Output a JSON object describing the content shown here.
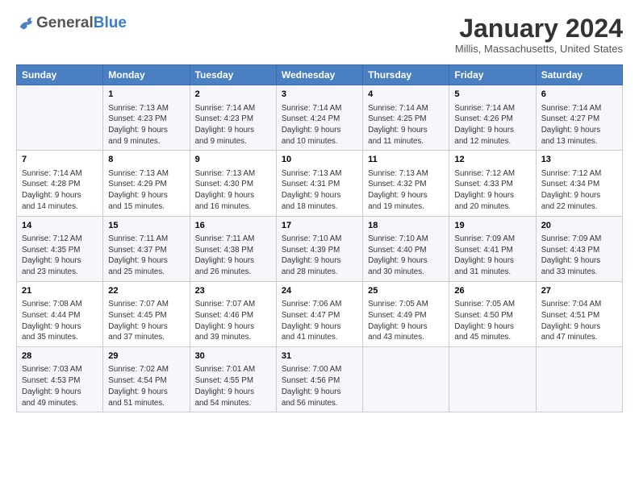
{
  "header": {
    "logo_general": "General",
    "logo_blue": "Blue",
    "title": "January 2024",
    "subtitle": "Millis, Massachusetts, United States"
  },
  "columns": [
    "Sunday",
    "Monday",
    "Tuesday",
    "Wednesday",
    "Thursday",
    "Friday",
    "Saturday"
  ],
  "weeks": [
    [
      {
        "num": "",
        "lines": []
      },
      {
        "num": "1",
        "lines": [
          "Sunrise: 7:13 AM",
          "Sunset: 4:23 PM",
          "Daylight: 9 hours",
          "and 9 minutes."
        ]
      },
      {
        "num": "2",
        "lines": [
          "Sunrise: 7:14 AM",
          "Sunset: 4:23 PM",
          "Daylight: 9 hours",
          "and 9 minutes."
        ]
      },
      {
        "num": "3",
        "lines": [
          "Sunrise: 7:14 AM",
          "Sunset: 4:24 PM",
          "Daylight: 9 hours",
          "and 10 minutes."
        ]
      },
      {
        "num": "4",
        "lines": [
          "Sunrise: 7:14 AM",
          "Sunset: 4:25 PM",
          "Daylight: 9 hours",
          "and 11 minutes."
        ]
      },
      {
        "num": "5",
        "lines": [
          "Sunrise: 7:14 AM",
          "Sunset: 4:26 PM",
          "Daylight: 9 hours",
          "and 12 minutes."
        ]
      },
      {
        "num": "6",
        "lines": [
          "Sunrise: 7:14 AM",
          "Sunset: 4:27 PM",
          "Daylight: 9 hours",
          "and 13 minutes."
        ]
      }
    ],
    [
      {
        "num": "7",
        "lines": [
          "Sunrise: 7:14 AM",
          "Sunset: 4:28 PM",
          "Daylight: 9 hours",
          "and 14 minutes."
        ]
      },
      {
        "num": "8",
        "lines": [
          "Sunrise: 7:13 AM",
          "Sunset: 4:29 PM",
          "Daylight: 9 hours",
          "and 15 minutes."
        ]
      },
      {
        "num": "9",
        "lines": [
          "Sunrise: 7:13 AM",
          "Sunset: 4:30 PM",
          "Daylight: 9 hours",
          "and 16 minutes."
        ]
      },
      {
        "num": "10",
        "lines": [
          "Sunrise: 7:13 AM",
          "Sunset: 4:31 PM",
          "Daylight: 9 hours",
          "and 18 minutes."
        ]
      },
      {
        "num": "11",
        "lines": [
          "Sunrise: 7:13 AM",
          "Sunset: 4:32 PM",
          "Daylight: 9 hours",
          "and 19 minutes."
        ]
      },
      {
        "num": "12",
        "lines": [
          "Sunrise: 7:12 AM",
          "Sunset: 4:33 PM",
          "Daylight: 9 hours",
          "and 20 minutes."
        ]
      },
      {
        "num": "13",
        "lines": [
          "Sunrise: 7:12 AM",
          "Sunset: 4:34 PM",
          "Daylight: 9 hours",
          "and 22 minutes."
        ]
      }
    ],
    [
      {
        "num": "14",
        "lines": [
          "Sunrise: 7:12 AM",
          "Sunset: 4:35 PM",
          "Daylight: 9 hours",
          "and 23 minutes."
        ]
      },
      {
        "num": "15",
        "lines": [
          "Sunrise: 7:11 AM",
          "Sunset: 4:37 PM",
          "Daylight: 9 hours",
          "and 25 minutes."
        ]
      },
      {
        "num": "16",
        "lines": [
          "Sunrise: 7:11 AM",
          "Sunset: 4:38 PM",
          "Daylight: 9 hours",
          "and 26 minutes."
        ]
      },
      {
        "num": "17",
        "lines": [
          "Sunrise: 7:10 AM",
          "Sunset: 4:39 PM",
          "Daylight: 9 hours",
          "and 28 minutes."
        ]
      },
      {
        "num": "18",
        "lines": [
          "Sunrise: 7:10 AM",
          "Sunset: 4:40 PM",
          "Daylight: 9 hours",
          "and 30 minutes."
        ]
      },
      {
        "num": "19",
        "lines": [
          "Sunrise: 7:09 AM",
          "Sunset: 4:41 PM",
          "Daylight: 9 hours",
          "and 31 minutes."
        ]
      },
      {
        "num": "20",
        "lines": [
          "Sunrise: 7:09 AM",
          "Sunset: 4:43 PM",
          "Daylight: 9 hours",
          "and 33 minutes."
        ]
      }
    ],
    [
      {
        "num": "21",
        "lines": [
          "Sunrise: 7:08 AM",
          "Sunset: 4:44 PM",
          "Daylight: 9 hours",
          "and 35 minutes."
        ]
      },
      {
        "num": "22",
        "lines": [
          "Sunrise: 7:07 AM",
          "Sunset: 4:45 PM",
          "Daylight: 9 hours",
          "and 37 minutes."
        ]
      },
      {
        "num": "23",
        "lines": [
          "Sunrise: 7:07 AM",
          "Sunset: 4:46 PM",
          "Daylight: 9 hours",
          "and 39 minutes."
        ]
      },
      {
        "num": "24",
        "lines": [
          "Sunrise: 7:06 AM",
          "Sunset: 4:47 PM",
          "Daylight: 9 hours",
          "and 41 minutes."
        ]
      },
      {
        "num": "25",
        "lines": [
          "Sunrise: 7:05 AM",
          "Sunset: 4:49 PM",
          "Daylight: 9 hours",
          "and 43 minutes."
        ]
      },
      {
        "num": "26",
        "lines": [
          "Sunrise: 7:05 AM",
          "Sunset: 4:50 PM",
          "Daylight: 9 hours",
          "and 45 minutes."
        ]
      },
      {
        "num": "27",
        "lines": [
          "Sunrise: 7:04 AM",
          "Sunset: 4:51 PM",
          "Daylight: 9 hours",
          "and 47 minutes."
        ]
      }
    ],
    [
      {
        "num": "28",
        "lines": [
          "Sunrise: 7:03 AM",
          "Sunset: 4:53 PM",
          "Daylight: 9 hours",
          "and 49 minutes."
        ]
      },
      {
        "num": "29",
        "lines": [
          "Sunrise: 7:02 AM",
          "Sunset: 4:54 PM",
          "Daylight: 9 hours",
          "and 51 minutes."
        ]
      },
      {
        "num": "30",
        "lines": [
          "Sunrise: 7:01 AM",
          "Sunset: 4:55 PM",
          "Daylight: 9 hours",
          "and 54 minutes."
        ]
      },
      {
        "num": "31",
        "lines": [
          "Sunrise: 7:00 AM",
          "Sunset: 4:56 PM",
          "Daylight: 9 hours",
          "and 56 minutes."
        ]
      },
      {
        "num": "",
        "lines": []
      },
      {
        "num": "",
        "lines": []
      },
      {
        "num": "",
        "lines": []
      }
    ]
  ]
}
